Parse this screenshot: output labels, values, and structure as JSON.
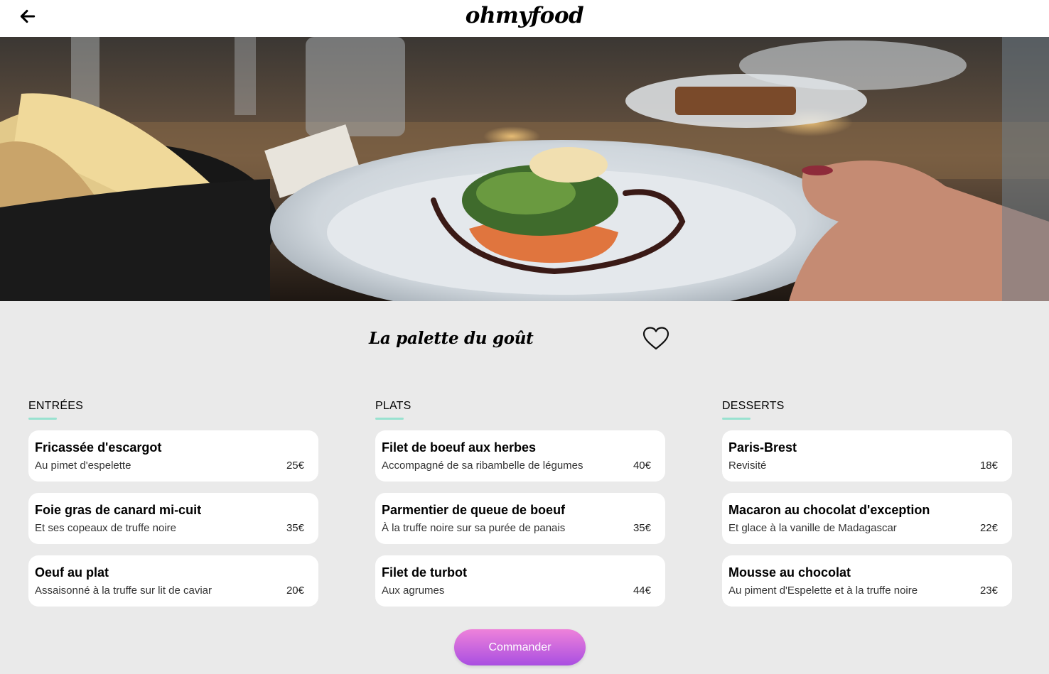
{
  "header": {
    "back_icon": "arrow-left-icon",
    "logo": "ohmyfood"
  },
  "hero": {
    "description_icon": "plated-dish-photo"
  },
  "restaurant": {
    "name": "La palette du goût",
    "favorite_icon": "heart-outline-icon"
  },
  "menu": {
    "accent_color": "#99e2d0",
    "sections": [
      {
        "title": "ENTRÉES",
        "items": [
          {
            "name": "Fricassée d'escargot",
            "description": "Au pimet d'espelette",
            "price": "25€"
          },
          {
            "name": "Foie gras de canard mi-cuit",
            "description": "Et ses copeaux de truffe noire",
            "price": "35€"
          },
          {
            "name": "Oeuf au plat",
            "description": "Assaisonné à la truffe sur lit de caviar",
            "price": "20€"
          }
        ]
      },
      {
        "title": "PLATS",
        "items": [
          {
            "name": "Filet de boeuf aux herbes",
            "description": "Accompagné de sa ribambelle de légumes",
            "price": "40€"
          },
          {
            "name": "Parmentier de queue de boeuf",
            "description": "À la truffe noire sur sa purée de panais",
            "price": "35€"
          },
          {
            "name": "Filet de turbot",
            "description": "Aux agrumes",
            "price": "44€"
          }
        ]
      },
      {
        "title": "DESSERTS",
        "items": [
          {
            "name": "Paris-Brest",
            "description": "Revisité",
            "price": "18€"
          },
          {
            "name": "Macaron au chocolat d'exception",
            "description": "Et glace à la vanille de Madagascar",
            "price": "22€"
          },
          {
            "name": "Mousse au chocolat",
            "description": "Au piment d'Espelette et à la truffe noire",
            "price": "23€"
          }
        ]
      }
    ]
  },
  "order": {
    "label": "Commander",
    "gradient_top": "#ee82da",
    "gradient_bottom": "#a94fe1"
  }
}
